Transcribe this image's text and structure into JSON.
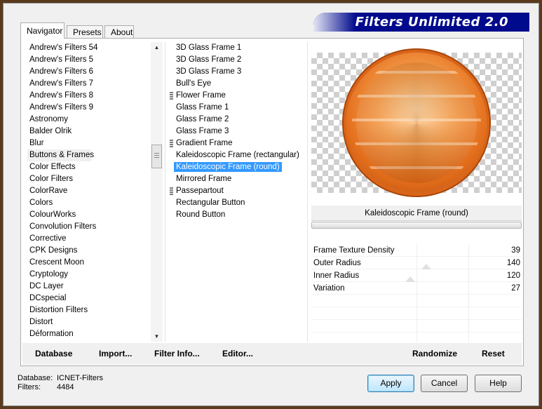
{
  "banner": {
    "title": "Filters Unlimited 2.0"
  },
  "tabs": [
    "Navigator",
    "Presets",
    "About"
  ],
  "categories": [
    "Andrew's Filters 54",
    "Andrew's Filters 5",
    "Andrew's Filters 6",
    "Andrew's Filters 7",
    "Andrew's Filters 8",
    "Andrew's Filters 9",
    "Astronomy",
    "Balder Olrik",
    "Blur",
    "Buttons & Frames",
    "Color Effects",
    "Color Filters",
    "ColorRave",
    "Colors",
    "ColourWorks",
    "Convolution Filters",
    "Corrective",
    "CPK Designs",
    "Crescent Moon",
    "Cryptology",
    "DC Layer",
    "DCspecial",
    "Distortion Filters",
    "Distort",
    "Déformation"
  ],
  "selected_category": "Buttons & Frames",
  "filters": [
    {
      "label": "3D Glass Frame 1",
      "grouped": false
    },
    {
      "label": "3D Glass Frame 2",
      "grouped": false
    },
    {
      "label": "3D Glass Frame 3",
      "grouped": false
    },
    {
      "label": "Bull's Eye",
      "grouped": false
    },
    {
      "label": "Flower Frame",
      "grouped": true
    },
    {
      "label": "Glass Frame 1",
      "grouped": false
    },
    {
      "label": "Glass Frame 2",
      "grouped": false
    },
    {
      "label": "Glass Frame 3",
      "grouped": false
    },
    {
      "label": "Gradient Frame",
      "grouped": true
    },
    {
      "label": "Kaleidoscopic Frame (rectangular)",
      "grouped": false
    },
    {
      "label": "Kaleidoscopic Frame (round)",
      "grouped": false
    },
    {
      "label": "Mirrored Frame",
      "grouped": false
    },
    {
      "label": "Passepartout",
      "grouped": true
    },
    {
      "label": "Rectangular Button",
      "grouped": false
    },
    {
      "label": "Round Button",
      "grouped": false
    }
  ],
  "selected_filter": "Kaleidoscopic Frame (round)",
  "preview": {
    "filter_name": "Kaleidoscopic Frame (round)"
  },
  "params": [
    {
      "label": "Frame Texture Density",
      "value": "39"
    },
    {
      "label": "Outer Radius",
      "value": "140"
    },
    {
      "label": "Inner Radius",
      "value": "120"
    },
    {
      "label": "Variation",
      "value": "27"
    }
  ],
  "bottom_links": {
    "database": "Database",
    "import": "Import...",
    "filter_info": "Filter Info...",
    "editor": "Editor...",
    "randomize": "Randomize",
    "reset": "Reset"
  },
  "status": {
    "database_label": "Database:",
    "database_value": "ICNET-Filters",
    "filters_label": "Filters:",
    "filters_value": "4484"
  },
  "buttons": {
    "apply": "Apply",
    "cancel": "Cancel",
    "help": "Help"
  },
  "colors": {
    "banner": "#000a8c",
    "selection": "#3399ff",
    "frame": "#5a3a1e"
  }
}
